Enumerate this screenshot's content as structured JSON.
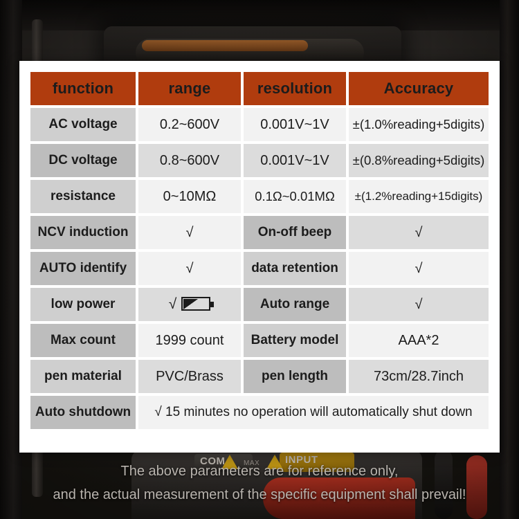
{
  "card": {
    "headers": [
      "function",
      "range",
      "resolution",
      "Accuracy"
    ],
    "rows": [
      {
        "type": "data",
        "cells": [
          "AC voltage",
          "0.2~600V",
          "0.001V~1V",
          "±(1.0%reading+5digits)"
        ]
      },
      {
        "type": "data",
        "cells": [
          "DC voltage",
          "0.8~600V",
          "0.001V~1V",
          "±(0.8%reading+5digits)"
        ]
      },
      {
        "type": "data",
        "cells": [
          "resistance",
          "0~10MΩ",
          "0.1Ω~0.01MΩ",
          "±(1.2%reading+15digits)"
        ]
      },
      {
        "type": "feature",
        "cells": [
          "NCV induction",
          "√",
          "On-off beep",
          "√"
        ]
      },
      {
        "type": "feature",
        "cells": [
          "AUTO identify",
          "√",
          "data retention",
          "√"
        ]
      },
      {
        "type": "feature-battery",
        "cells": [
          "low power",
          "√",
          "Auto range",
          "√"
        ]
      },
      {
        "type": "feature",
        "cells": [
          "Max count",
          "1999 count",
          "Battery model",
          "AAA*2"
        ]
      },
      {
        "type": "feature",
        "cells": [
          "pen material",
          "PVC/Brass",
          "pen length",
          "73cm/28.7inch"
        ]
      }
    ],
    "last_row": {
      "label": "Auto shutdown",
      "value": "√ 15 minutes no operation will automatically shut down"
    }
  },
  "footer": {
    "line1": "The above parameters are for reference only,",
    "line2": "and the actual measurement of the specific equipment shall prevail!"
  },
  "background": {
    "com_label": "COM",
    "max_label": "MAX",
    "input_label": "INPUT"
  },
  "colors": {
    "header_orange": "#b03c0e",
    "label_light": "#cfcfcf",
    "label_dark": "#bdbdbd",
    "value_light": "#f2f2f2",
    "value_dark": "#dcdcdc",
    "card_bg": "#ffffff",
    "footer_text": "#b9b4ae"
  }
}
